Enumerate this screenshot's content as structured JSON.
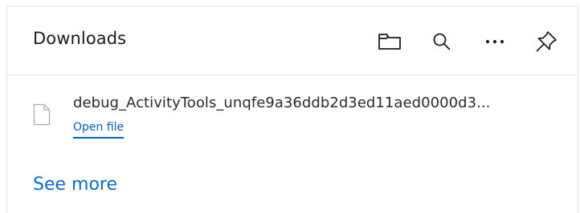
{
  "header": {
    "title": "Downloads",
    "icons": {
      "folder": "folder-icon",
      "search": "search-icon",
      "more": "more-options-icon",
      "pin": "pin-icon"
    }
  },
  "downloads": {
    "items": [
      {
        "file_name": "debug_ActivityTools_unqfe9a36ddb2d3ed11aed0000d3...",
        "action_label": "Open file",
        "icon": "document-icon"
      }
    ]
  },
  "footer": {
    "see_more_label": "See more"
  },
  "colors": {
    "link": "#0f6cbd",
    "divider": "#e3e3e3",
    "text": "#1b1b1b"
  }
}
